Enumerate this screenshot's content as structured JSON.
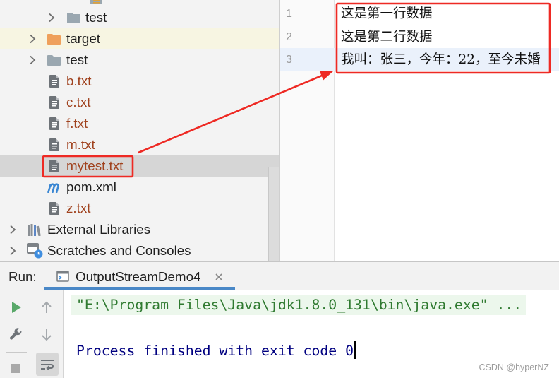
{
  "colors": {
    "annotation_red": "#ee2a24",
    "tab_underline": "#4a88c7",
    "unversioned_file_text": "#a0421e",
    "console_command_text": "#2f7a30",
    "console_exit_text": "#000080",
    "current_line": "#eaf1fb",
    "run_icon": "#59a869",
    "excluded_folder": "#efa05b",
    "folder": "#9aa7b0"
  },
  "project_tree": {
    "items": [
      {
        "label": "test",
        "icon": "folder-icon",
        "expandable": true
      },
      {
        "label": "target",
        "icon": "excluded-folder-icon",
        "expandable": true
      },
      {
        "label": "test",
        "icon": "folder-icon",
        "expandable": true
      },
      {
        "label": "b.txt",
        "icon": "text-file-icon"
      },
      {
        "label": "c.txt",
        "icon": "text-file-icon"
      },
      {
        "label": "f.txt",
        "icon": "text-file-icon"
      },
      {
        "label": "m.txt",
        "icon": "text-file-icon"
      },
      {
        "label": "mytest.txt",
        "icon": "text-file-icon",
        "selected": true
      },
      {
        "label": "pom.xml",
        "icon": "maven-icon"
      },
      {
        "label": "z.txt",
        "icon": "text-file-icon"
      },
      {
        "label": "External Libraries",
        "icon": "libraries-icon",
        "expandable": true
      },
      {
        "label": "Scratches and Consoles",
        "icon": "scratches-icon",
        "expandable": true
      }
    ]
  },
  "editor": {
    "lines": [
      {
        "number": "1",
        "text": "这是第一行数据"
      },
      {
        "number": "2",
        "text": "这是第二行数据"
      },
      {
        "number": "3",
        "text": "我叫：张三，今年：22，至今未婚",
        "current": true
      }
    ]
  },
  "run_panel": {
    "label": "Run:",
    "tab_title": "OutputStreamDemo4",
    "tab_icon": "console-icon",
    "toolbar_icons": [
      "run-icon",
      "up-arrow-icon",
      "wrench-icon",
      "down-arrow-icon",
      "stop-icon",
      "soft-wrap-icon"
    ],
    "console_lines": [
      "\"E:\\Program Files\\Java\\jdk1.8.0_131\\bin\\java.exe\" ...",
      "Process finished with exit code 0"
    ]
  },
  "watermark": "CSDN @hyperNZ"
}
